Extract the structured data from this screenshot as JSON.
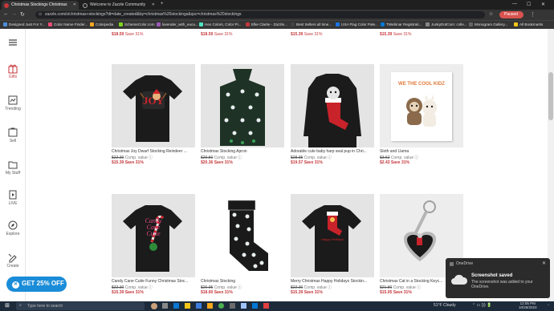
{
  "tabs": [
    {
      "title": "Christmas Stockings Christmas",
      "active": true
    },
    {
      "title": "Welcome to Zazzle Community",
      "active": false
    }
  ],
  "address": {
    "url": "zazzle.com/s/christmas+stockings?dt=date_created&by=christmas%20stockings&qsc=christmas%20stockings"
  },
  "profile": {
    "status": "Paused"
  },
  "bookmarks": [
    {
      "label": "Designed Just For Y...",
      "color": "#4a90d9"
    },
    {
      "label": "Color Name Finder...",
      "color": "#e94e77"
    },
    {
      "label": "Colorpedia",
      "color": "#f5a623"
    },
    {
      "label": "SchemeColor.com",
      "color": "#7ed321"
    },
    {
      "label": "lavender_with_euca...",
      "color": "#9b59b6"
    },
    {
      "label": "Hex Colors, Color Pi...",
      "color": "#50e3c2"
    },
    {
      "label": "Elke Clarke - Zazzle...",
      "color": "#c5373a"
    },
    {
      "label": "Best Sellers all time...",
      "color": "#444444"
    },
    {
      "label": "USA Flag Color Pale...",
      "color": "#1a73e8"
    },
    {
      "label": "TWebinar Registrati...",
      "color": "#0078d4"
    },
    {
      "label": "JunkyDotCom: colle...",
      "color": "#888888"
    },
    {
      "label": "Monogram Gallery...",
      "color": "#666666"
    },
    {
      "label": "All Bookmarks",
      "color": "#f5c518"
    }
  ],
  "sidebar": [
    {
      "label": "Gifts",
      "icon": "gift-icon",
      "active": true
    },
    {
      "label": "Trending",
      "icon": "trending-icon",
      "active": false
    },
    {
      "label": "Sell",
      "icon": "sell-icon",
      "active": false
    },
    {
      "label": "My Stuff",
      "icon": "folder-icon",
      "active": false
    },
    {
      "label": "LIVE",
      "icon": "live-icon",
      "active": false
    },
    {
      "label": "Explore",
      "icon": "compass-icon",
      "active": false
    },
    {
      "label": "Create",
      "icon": "pencil-ruler-icon",
      "active": false
    }
  ],
  "top_prices": [
    {
      "price": "$18.59",
      "save": "Save 31%"
    },
    {
      "price": "$18.59",
      "save": "Save 31%"
    },
    {
      "price": "$15.39",
      "save": "Save 31%"
    },
    {
      "price": "$15.39",
      "save": "Save 31%"
    }
  ],
  "products": [
    {
      "title": "Christmas Joy Dwarf Stocking Reindeer ...",
      "comp": "$22.30",
      "comp_label": "Comp. value",
      "price": "$15.39",
      "save": "Save 31%"
    },
    {
      "title": "Christmas Stocking Apron",
      "comp": "$29.50",
      "comp_label": "Comp. value",
      "price": "$20.36",
      "save": "Save 31%"
    },
    {
      "title": "Adorable cute baby harp seal pup in Chri...",
      "comp": "$28.35",
      "comp_label": "Comp. value",
      "price": "$19.57",
      "save": "Save 31%"
    },
    {
      "title": "Sloth and Llama",
      "comp": "$3.52",
      "comp_label": "Comp. value",
      "price": "$2.43",
      "save": "Save 31%",
      "card_text": "WE THE COOL KIDZ"
    },
    {
      "title": "Candy Cane Cutie Funny Christmas Stoc...",
      "comp": "$22.30",
      "comp_label": "Comp. value",
      "price": "$15.39",
      "save": "Save 31%",
      "card_text": "Candy Cane Cutie"
    },
    {
      "title": "Christmas Stocking",
      "comp": "$26.95",
      "comp_label": "Comp. value",
      "price": "$18.60",
      "save": "Save 31%"
    },
    {
      "title": "Merry Christmas Happy Holidays Stockin...",
      "comp": "$22.30",
      "comp_label": "Comp. value",
      "price": "$15.39",
      "save": "Save 31%",
      "card_text": "Happy Holidays"
    },
    {
      "title": "Christmas Cat in a Stocking Keyc...",
      "comp": "$21.80",
      "comp_label": "Comp. value",
      "price": "$15.05",
      "save": "Save 31%"
    }
  ],
  "promo": {
    "label": "GET 25% OFF"
  },
  "toast": {
    "app": "OneDrive",
    "title": "Screenshot saved",
    "body": "The screenshot was added to your OneDrive."
  },
  "taskbar": {
    "search": "Type here to search",
    "weather": "51°F Cloudy",
    "time": "12:05 PM",
    "date": "10/28/2023"
  },
  "colors": {
    "sale_red": "#c5373a",
    "promo_blue": "#1a8cd8",
    "browser_dark": "#353535"
  }
}
